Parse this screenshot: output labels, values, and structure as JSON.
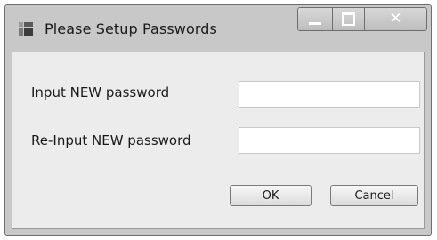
{
  "window": {
    "title": "Please Setup Passwords",
    "controls": {
      "minimize_icon": "minimize-icon",
      "maximize_icon": "maximize-icon",
      "close_glyph": "✕"
    }
  },
  "form": {
    "new_password_label": "Input NEW password",
    "new_password_value": "",
    "confirm_password_label": "Re-Input NEW password",
    "confirm_password_value": ""
  },
  "buttons": {
    "ok_label": "OK",
    "cancel_label": "Cancel"
  },
  "colors": {
    "window_bg": "#c8c8c8",
    "client_bg": "#ececec",
    "input_bg": "#ffffff"
  }
}
